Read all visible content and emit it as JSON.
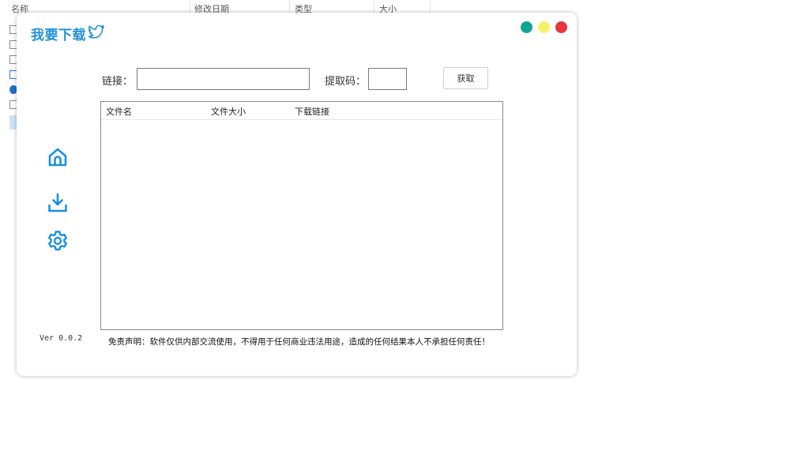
{
  "explorer": {
    "columns": [
      "名称",
      "修改日期",
      "类型",
      "大小"
    ]
  },
  "app": {
    "title": "我要下载",
    "version": "Ver 0.0.2",
    "window_controls": {
      "colors": [
        "#12a594",
        "#f7f16a",
        "#e8343e"
      ]
    },
    "sidebar": {
      "items": [
        {
          "name": "home-icon"
        },
        {
          "name": "download-icon"
        },
        {
          "name": "settings-gear-icon"
        }
      ]
    },
    "form": {
      "link_label": "链接：",
      "link_value": "",
      "code_label": "提取码：",
      "code_value": "",
      "fetch_button": "获取"
    },
    "table": {
      "columns": [
        "文件名",
        "文件大小",
        "下载链接"
      ],
      "rows": []
    },
    "disclaimer": "免责声明：软件仅供内部交流使用，不得用于任何商业违法用途，造成的任何结果本人不承担任何责任！",
    "accent_color": "#2392d8"
  }
}
